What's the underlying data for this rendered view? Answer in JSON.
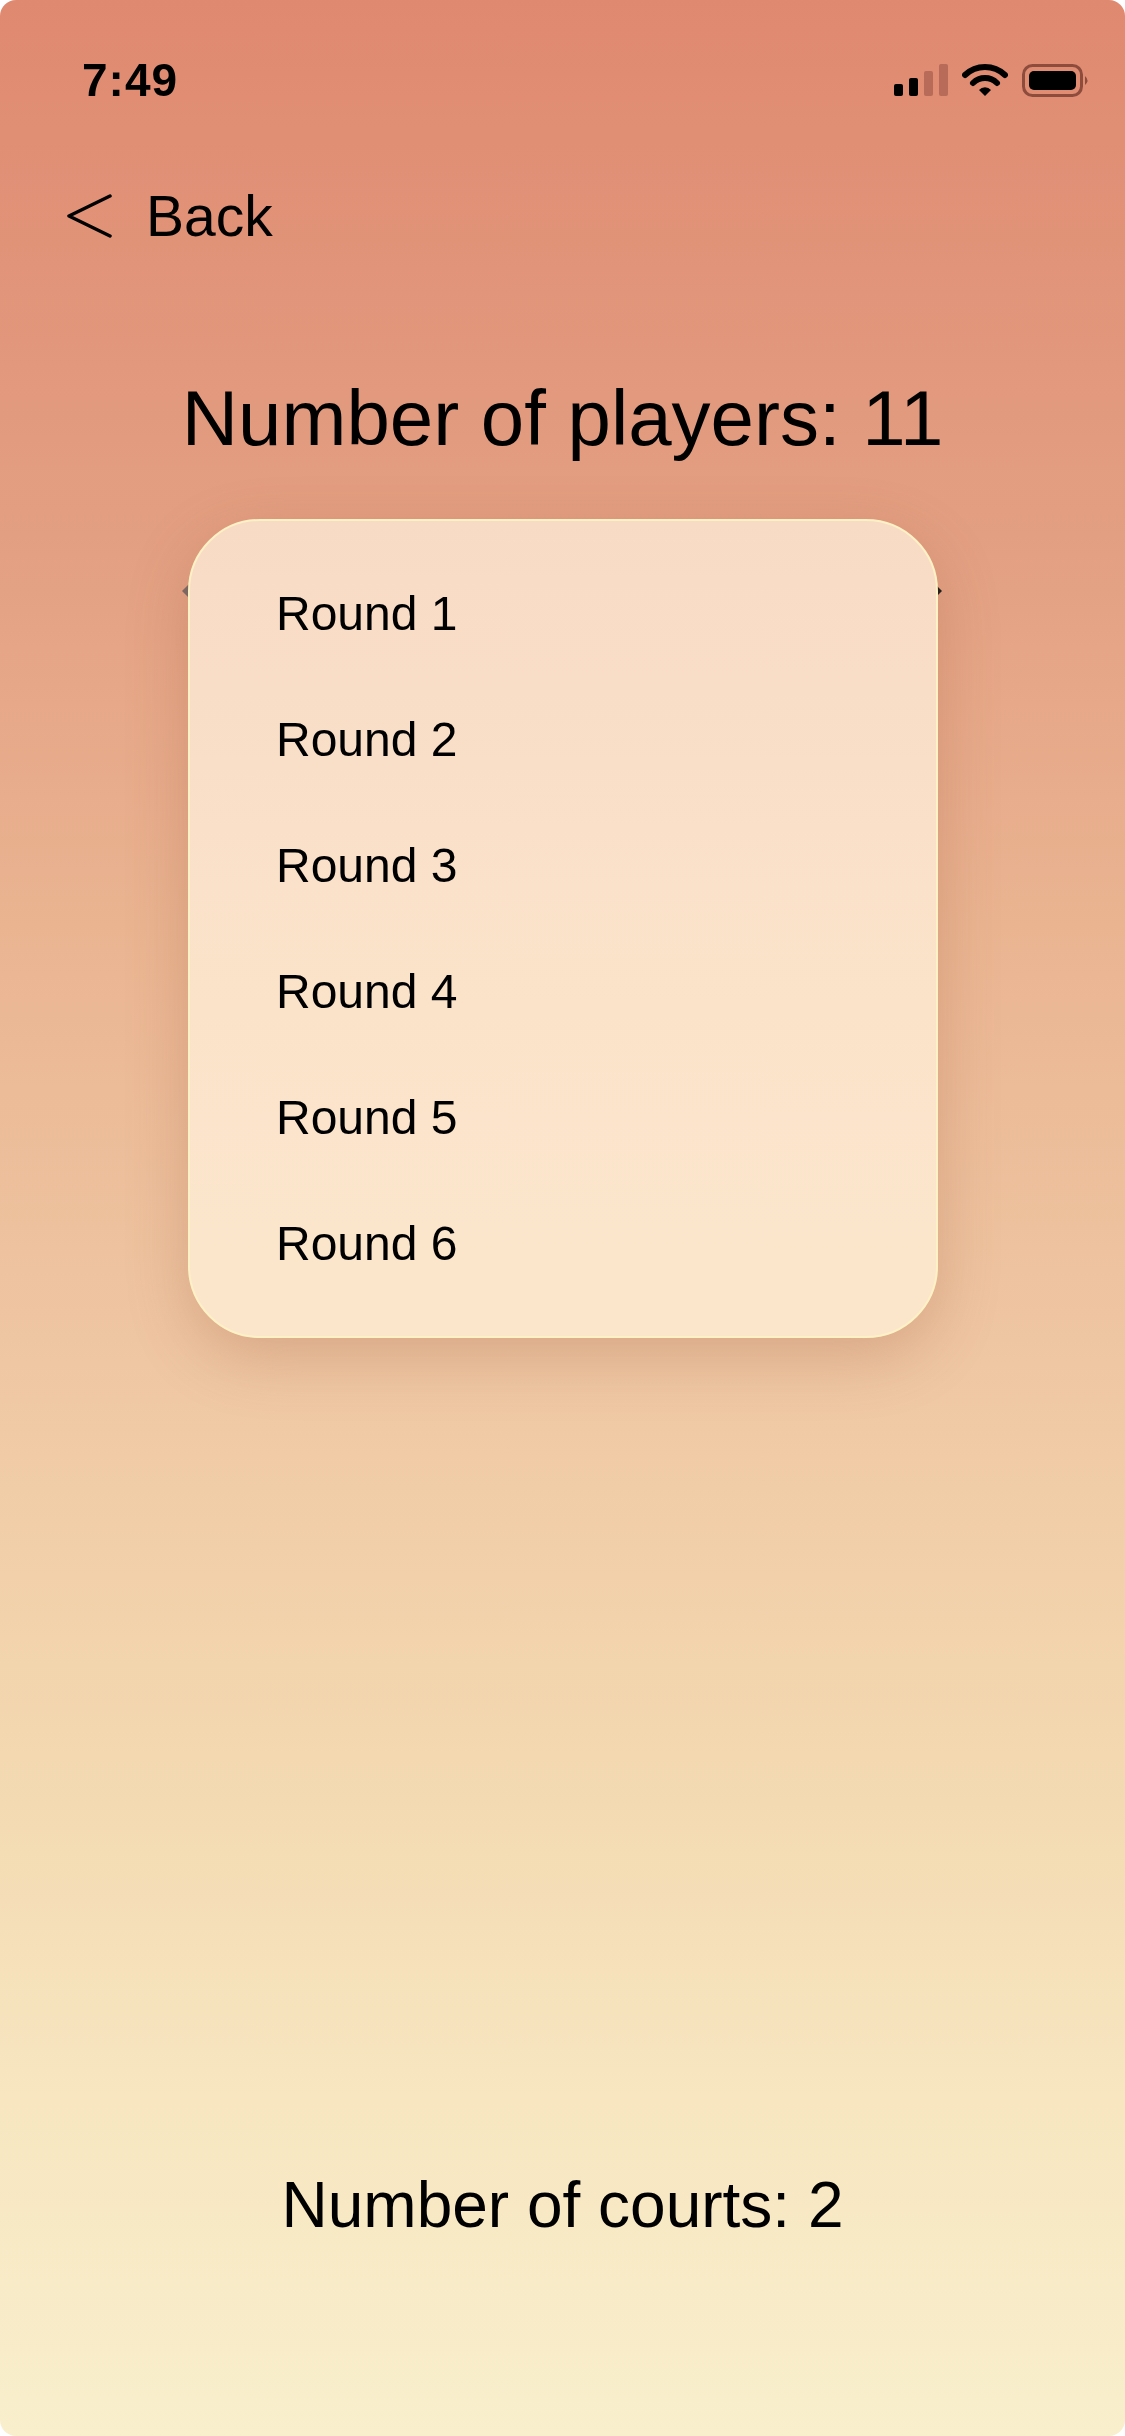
{
  "status_bar": {
    "time": "7:49"
  },
  "nav": {
    "back": {
      "label": "Back"
    }
  },
  "title": "Number of players: 11",
  "menu": {
    "items": [
      {
        "label": "Round 1"
      },
      {
        "label": "Round 2"
      },
      {
        "label": "Round 3"
      },
      {
        "label": "Round 4"
      },
      {
        "label": "Round 5"
      },
      {
        "label": "Round 6"
      }
    ]
  },
  "footer": {
    "text": "Number of courts: 2"
  }
}
